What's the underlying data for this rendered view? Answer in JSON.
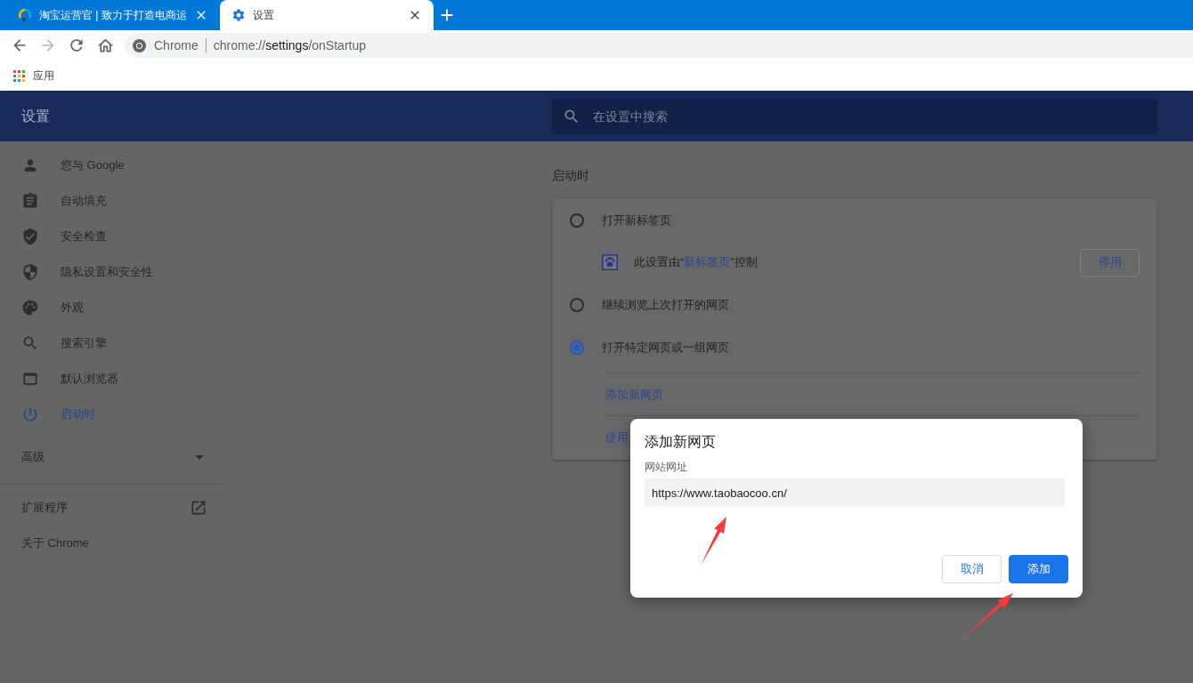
{
  "tab_strip": {
    "tabs": [
      {
        "title": "淘宝运营官 | 致力于打造电商运",
        "selected": false
      },
      {
        "title": "设置",
        "selected": true
      }
    ]
  },
  "toolbar": {
    "back_disabled": false,
    "forward_disabled": true,
    "omnibox": {
      "site_label": "Chrome",
      "url_scheme": "chrome://",
      "url_host": "settings",
      "url_path": "/onStartup"
    }
  },
  "bookmarks_bar": {
    "items": [
      {
        "label": "应用"
      }
    ]
  },
  "settings": {
    "title": "设置",
    "search": {
      "placeholder": "在设置中搜索"
    },
    "sidebar": {
      "items": [
        {
          "label": "您与 Google",
          "selected": false
        },
        {
          "label": "自动填充",
          "selected": false
        },
        {
          "label": "安全检查",
          "selected": false
        },
        {
          "label": "隐私设置和安全性",
          "selected": false
        },
        {
          "label": "外观",
          "selected": false
        },
        {
          "label": "搜索引擎",
          "selected": false
        },
        {
          "label": "默认浏览器",
          "selected": false
        },
        {
          "label": "启动时",
          "selected": true
        }
      ],
      "advanced": {
        "label": "高级",
        "expanded": false
      },
      "links": [
        {
          "label": "扩展程序",
          "external": true
        },
        {
          "label": "关于 Chrome",
          "external": false
        }
      ]
    },
    "section": {
      "title": "启动时",
      "options": [
        {
          "label": "打开新标签页",
          "selected": false,
          "notice": {
            "before": "此设置由“",
            "link": "新标签页",
            "after": "”控制",
            "button": "停用"
          }
        },
        {
          "label": "继续浏览上次打开的网页",
          "selected": false
        },
        {
          "label": "打开特定网页或一组网页",
          "selected": true,
          "actions": [
            "添加新网页",
            "使用"
          ]
        }
      ]
    }
  },
  "dialog": {
    "title": "添加新网页",
    "field": {
      "label": "网站网址",
      "value": "https://www.taobaocoo.cn/"
    },
    "buttons": [
      {
        "label": "取消",
        "kind": "secondary"
      },
      {
        "label": "添加",
        "kind": "primary"
      }
    ]
  }
}
